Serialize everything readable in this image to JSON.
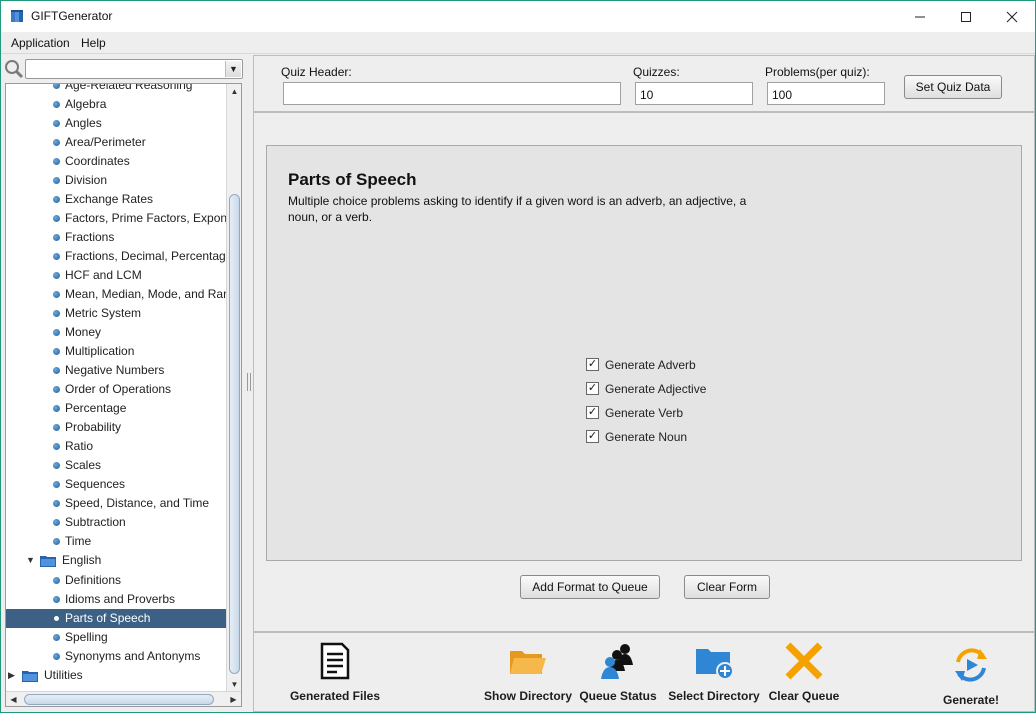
{
  "window": {
    "title": "GIFTGenerator",
    "minimize": "—",
    "maximize": "☐",
    "close": "✕"
  },
  "menu": {
    "application": "Application",
    "help": "Help"
  },
  "tree": {
    "items": [
      {
        "label": "Age-Related Reasoning",
        "type": "leaf"
      },
      {
        "label": "Algebra",
        "type": "leaf"
      },
      {
        "label": "Angles",
        "type": "leaf"
      },
      {
        "label": "Area/Perimeter",
        "type": "leaf"
      },
      {
        "label": "Coordinates",
        "type": "leaf"
      },
      {
        "label": "Division",
        "type": "leaf"
      },
      {
        "label": "Exchange Rates",
        "type": "leaf"
      },
      {
        "label": "Factors, Prime Factors, Exponents",
        "type": "leaf"
      },
      {
        "label": "Fractions",
        "type": "leaf"
      },
      {
        "label": "Fractions, Decimal, Percentage",
        "type": "leaf"
      },
      {
        "label": "HCF and LCM",
        "type": "leaf"
      },
      {
        "label": "Mean, Median, Mode, and Range",
        "type": "leaf"
      },
      {
        "label": "Metric System",
        "type": "leaf"
      },
      {
        "label": "Money",
        "type": "leaf"
      },
      {
        "label": "Multiplication",
        "type": "leaf"
      },
      {
        "label": "Negative Numbers",
        "type": "leaf"
      },
      {
        "label": "Order of Operations",
        "type": "leaf"
      },
      {
        "label": "Percentage",
        "type": "leaf"
      },
      {
        "label": "Probability",
        "type": "leaf"
      },
      {
        "label": "Ratio",
        "type": "leaf"
      },
      {
        "label": "Scales",
        "type": "leaf"
      },
      {
        "label": "Sequences",
        "type": "leaf"
      },
      {
        "label": "Speed, Distance, and Time",
        "type": "leaf"
      },
      {
        "label": "Subtraction",
        "type": "leaf"
      },
      {
        "label": "Time",
        "type": "leaf"
      },
      {
        "label": "English",
        "type": "folder",
        "expanded": true
      },
      {
        "label": "Definitions",
        "type": "leaf"
      },
      {
        "label": "Idioms and Proverbs",
        "type": "leaf"
      },
      {
        "label": "Parts of Speech",
        "type": "leaf",
        "selected": true
      },
      {
        "label": "Spelling",
        "type": "leaf"
      },
      {
        "label": "Synonyms and Antonyms",
        "type": "leaf"
      },
      {
        "label": "Utilities",
        "type": "folder",
        "expanded": false
      }
    ]
  },
  "quiz": {
    "header_label": "Quiz Header:",
    "header_value": "",
    "quizzes_label": "Quizzes:",
    "quizzes_value": "10",
    "problems_label": "Problems(per quiz):",
    "problems_value": "100",
    "set_button": "Set Quiz Data"
  },
  "format": {
    "title": "Parts of Speech",
    "description": "Multiple choice problems asking to identify if a given word is an adverb, an adjective, a noun, or a verb.",
    "options": [
      {
        "label": "Generate Adverb",
        "checked": true
      },
      {
        "label": "Generate Adjective",
        "checked": true
      },
      {
        "label": "Generate Verb",
        "checked": true
      },
      {
        "label": "Generate Noun",
        "checked": true
      }
    ],
    "add_button": "Add Format to Queue",
    "clear_button": "Clear Form"
  },
  "toolbar": {
    "generated_files": "Generated Files",
    "show_directory": "Show Directory",
    "queue_status": "Queue Status",
    "select_directory": "Select Directory",
    "clear_queue": "Clear Queue",
    "generate": "Generate!"
  },
  "colors": {
    "accent": "#3d6185",
    "border": "#1f9a7a",
    "folder": "#f5b642",
    "clear": "#f5a100",
    "blue": "#2f86d4"
  }
}
